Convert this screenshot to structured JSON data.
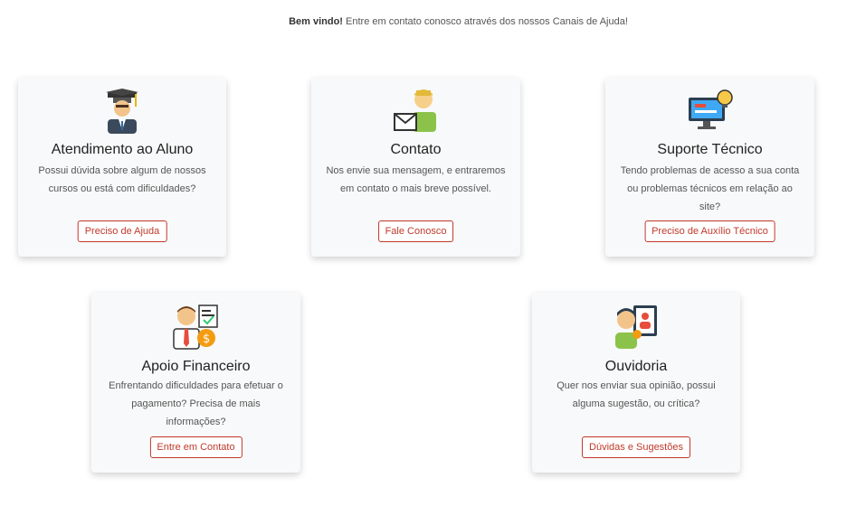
{
  "intro": {
    "bold": "Bem vindo!",
    "text": "Entre em contato conosco através dos nossos Canais de Ajuda!"
  },
  "cards": [
    {
      "icon": "graduate-icon",
      "title": "Atendimento ao Aluno",
      "desc": "Possui dúvida sobre algum de nossos cursos ou está com dificuldades?",
      "button": "Preciso de Ajuda"
    },
    {
      "icon": "contact-mail-icon",
      "title": "Contato",
      "desc": "Nos envie sua mensagem, e entraremos em contato o mais breve possível.",
      "button": "Fale Conosco"
    },
    {
      "icon": "tech-support-icon",
      "title": "Suporte Técnico",
      "desc": "Tendo problemas de acesso a sua conta ou problemas técnicos em relação ao site?",
      "button": "Preciso de Auxílio Técnico"
    },
    {
      "icon": "financial-support-icon",
      "title": "Apoio Financeiro",
      "desc": "Enfrentando dificuldades para efetuar o pagamento? Precisa de mais informações?",
      "button": "Entre em Contato"
    },
    {
      "icon": "ombudsman-icon",
      "title": "Ouvidoria",
      "desc": "Quer nos enviar sua opinião, possui alguma sugestão, ou crítica?",
      "button": "Dúvidas e Sugestões"
    }
  ]
}
